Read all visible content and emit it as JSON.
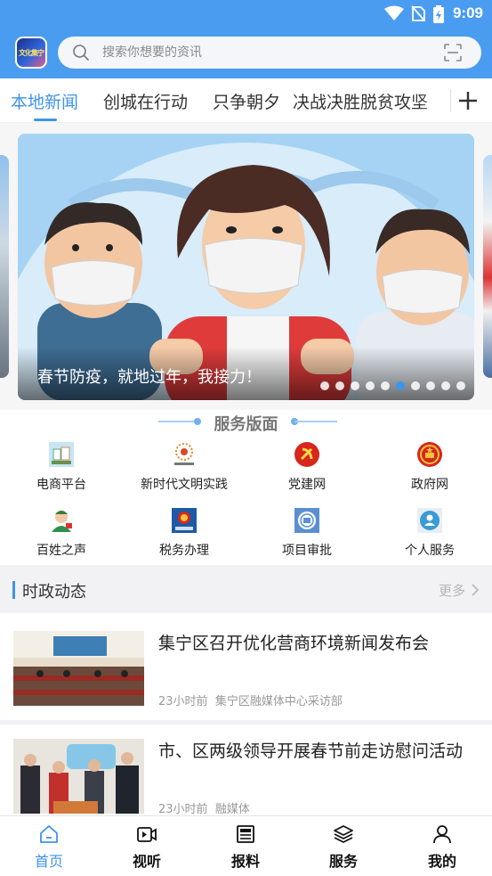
{
  "status_bar": {
    "time": "9:09"
  },
  "header": {
    "logo_text": "文化集宁",
    "search": {
      "placeholder": "搜索你想要的资讯"
    }
  },
  "tabs": [
    {
      "label": "本地新闻",
      "active": true
    },
    {
      "label": "创城在行动"
    },
    {
      "label": "只争朝夕"
    },
    {
      "label": "决战决胜脱贫攻坚"
    }
  ],
  "banner": {
    "caption": "春节防疫，就地过年，我接力！",
    "slide_count": 10,
    "active_slide": 5
  },
  "services": {
    "title": "服务版面",
    "items": [
      {
        "label": "电商平台",
        "icon": "ecommerce-icon"
      },
      {
        "label": "新时代文明实践",
        "icon": "civilization-icon"
      },
      {
        "label": "党建网",
        "icon": "party-emblem-icon"
      },
      {
        "label": "政府网",
        "icon": "national-emblem-icon"
      },
      {
        "label": "百姓之声",
        "icon": "people-voice-icon"
      },
      {
        "label": "税务办理",
        "icon": "tax-icon"
      },
      {
        "label": "项目审批",
        "icon": "approval-icon"
      },
      {
        "label": "个人服务",
        "icon": "personal-service-icon"
      }
    ]
  },
  "section": {
    "title": "时政动态",
    "more_label": "更多"
  },
  "news": [
    {
      "title": "集宁区召开优化营商环境新闻发布会",
      "time": "23小时前",
      "source": "集宁区融媒体中心采访部"
    },
    {
      "title": "市、区两级领导开展春节前走访慰问活动",
      "time": "23小时前",
      "source": "融媒体"
    }
  ],
  "bottom_nav": [
    {
      "label": "首页",
      "icon": "home-icon",
      "active": true
    },
    {
      "label": "视听",
      "icon": "video-icon"
    },
    {
      "label": "报料",
      "icon": "news-report-icon"
    },
    {
      "label": "服务",
      "icon": "layers-icon"
    },
    {
      "label": "我的",
      "icon": "user-icon"
    }
  ],
  "colors": {
    "primary": "#3f94ea",
    "header": "#4a9cf0"
  }
}
